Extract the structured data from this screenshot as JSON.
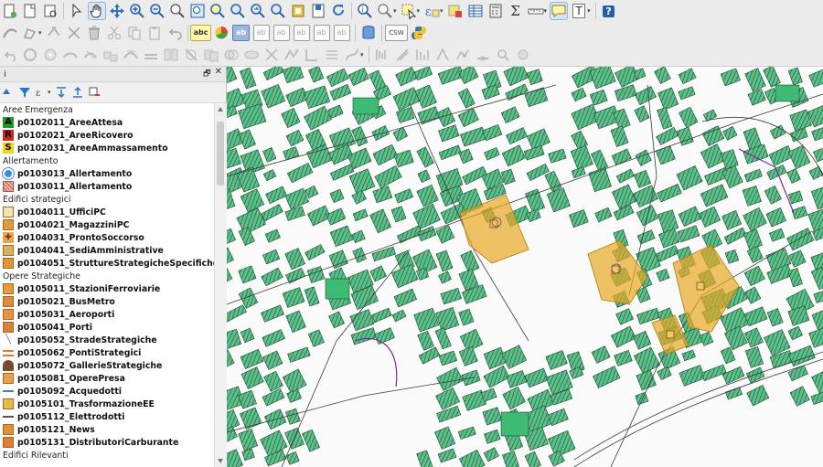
{
  "panel": {
    "title": "i",
    "float_glyph": "🗗",
    "close_glyph": "✕"
  },
  "layers": [
    {
      "kind": "group",
      "label": "Aree Emergenza"
    },
    {
      "kind": "layer",
      "label": "p0102011_AreeAttesa",
      "sym": "letter",
      "letter": "A",
      "bg": "#1f9a2a",
      "fg": "#000000"
    },
    {
      "kind": "layer",
      "label": "p0102021_AreeRicovero",
      "sym": "letter",
      "letter": "R",
      "bg": "#d0261f",
      "fg": "#000000"
    },
    {
      "kind": "layer",
      "label": "p0102031_AreeAmmassamento",
      "sym": "letter",
      "letter": "S",
      "bg": "#f2d21b",
      "fg": "#000000"
    },
    {
      "kind": "group",
      "label": "Allertamento"
    },
    {
      "kind": "layer",
      "label": "p0103013_Allertamento",
      "sym": "circle",
      "bg": "#3a8fd8"
    },
    {
      "kind": "layer",
      "label": "p0103011_Allertamento",
      "sym": "hatch",
      "bg": "#e8b7a8"
    },
    {
      "kind": "group",
      "label": "Edifici strategici"
    },
    {
      "kind": "layer",
      "label": "p0104011_UfficiPC",
      "sym": "box",
      "bg": "#f4e6b4"
    },
    {
      "kind": "layer",
      "label": "p0104021_MagazziniPC",
      "sym": "box",
      "bg": "#e39a3b"
    },
    {
      "kind": "layer",
      "label": "p0104031_ProntoSoccorso",
      "sym": "cross",
      "bg": "#e5a650"
    },
    {
      "kind": "layer",
      "label": "p0104041_SediAmministrative",
      "sym": "box",
      "bg": "#d7b361"
    },
    {
      "kind": "layer",
      "label": "p0104051_StruttureStrategicheSpecifiche",
      "sym": "box",
      "bg": "#e0953c"
    },
    {
      "kind": "group",
      "label": "Opere Strategiche"
    },
    {
      "kind": "layer",
      "label": "p0105011_StazioniFerroviarie",
      "sym": "box",
      "bg": "#e59a42"
    },
    {
      "kind": "layer",
      "label": "p0105021_BusMetro",
      "sym": "box",
      "bg": "#e0893a"
    },
    {
      "kind": "layer",
      "label": "p0105031_Aeroporti",
      "sym": "box",
      "bg": "#e79340"
    },
    {
      "kind": "layer",
      "label": "p0105041_Porti",
      "sym": "box",
      "bg": "#d9813c"
    },
    {
      "kind": "layer",
      "label": "p0105052_StradeStrategiche",
      "sym": "vline",
      "bg": "#777777"
    },
    {
      "kind": "layer",
      "label": "p0105062_PontiStrategici",
      "sym": "bridge",
      "bg": "#e27a2e"
    },
    {
      "kind": "layer",
      "label": "p0105072_GallerieStrategiche",
      "sym": "tunnel",
      "bg": "#7a4a2a"
    },
    {
      "kind": "layer",
      "label": "p0105081_OperePresa",
      "sym": "box",
      "bg": "#e2a14a"
    },
    {
      "kind": "layer",
      "label": "p0105092_Acquedotti",
      "sym": "dash",
      "bg": "#3d7fd6"
    },
    {
      "kind": "layer",
      "label": "p0105101_TrasformazioneEE",
      "sym": "box",
      "bg": "#e6b949"
    },
    {
      "kind": "layer",
      "label": "p0105112_Elettrodotti",
      "sym": "dash",
      "bg": "#555555"
    },
    {
      "kind": "layer",
      "label": "p0105121_News",
      "sym": "box",
      "bg": "#e48f3a"
    },
    {
      "kind": "layer",
      "label": "p0105131_DistributoriCarburante",
      "sym": "box",
      "bg": "#de7d33"
    },
    {
      "kind": "group",
      "label": "Edifici Rilevanti"
    }
  ],
  "toolbar": {
    "csw_label": "CSW",
    "abc_label": "abc",
    "sigma_label": "Σ",
    "help_label": "?",
    "label_t": "T"
  },
  "colors": {
    "building_fill": "#5fc08d",
    "building_hatch": "#1e6e3e",
    "strategic_fill": "#e8a823",
    "road_line": "#3b3b3b",
    "boundary": "#7a2a8a"
  }
}
